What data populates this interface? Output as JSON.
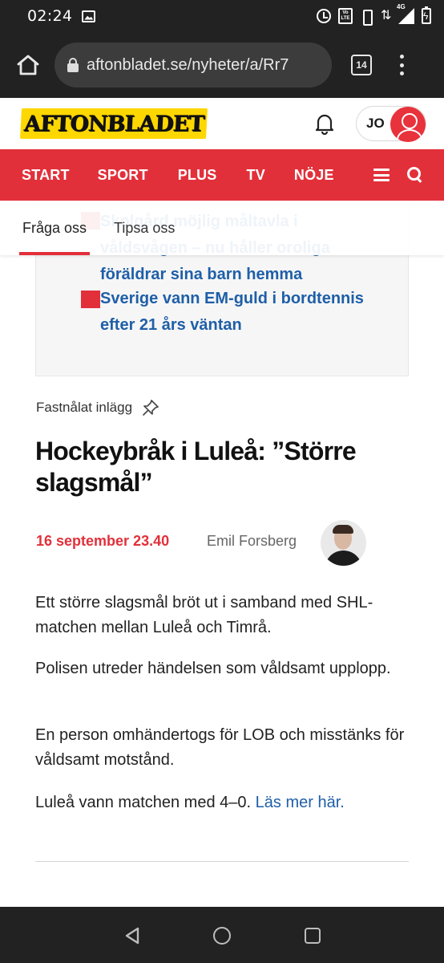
{
  "status_bar": {
    "time": "02:24",
    "icons": [
      "image-icon",
      "alarm-icon",
      "volte-icon",
      "vibrate-icon",
      "data-icon",
      "signal-icon",
      "battery-icon"
    ],
    "network_label": "4G",
    "volte_label": "Vo LTE"
  },
  "browser": {
    "url": "aftonbladet.se/nyheter/a/Rr7",
    "tab_count": "14"
  },
  "site": {
    "logo_text": "AFTONBLADET",
    "account_initials": "JO",
    "brand_colors": {
      "red": "#e2303a",
      "yellow": "#ffd700",
      "link_blue": "#1f5fa8"
    }
  },
  "nav": {
    "items": [
      "START",
      "SPORT",
      "PLUS",
      "TV",
      "NÖJE"
    ]
  },
  "sub_tabs": {
    "active": "Fråga oss",
    "second": "Tipsa oss"
  },
  "related": {
    "items": [
      {
        "label": "Skolgård möjlig måltavla i våldsvågen – nu håller oroliga föräldrar sina barn hemma"
      },
      {
        "label": "Sverige vann EM-guld i bordtennis efter 21 års väntan"
      }
    ]
  },
  "article": {
    "pinned_label": "Fastnålat inlägg",
    "headline": "Hockeybråk i Luleå: ”Större slagsmål”",
    "time": "16 september 23.40",
    "author": "Emil Forsberg",
    "paragraphs": [
      "Ett större slagsmål bröt ut i samband med SHL-matchen mellan Luleå och Timrå.",
      "Polisen utreder händelsen som våldsamt upplopp.",
      "En person omhändertogs för LOB och misstänks för våldsamt motstånd.",
      "Luleå vann matchen med 4–0."
    ],
    "read_more": "Läs mer här."
  }
}
